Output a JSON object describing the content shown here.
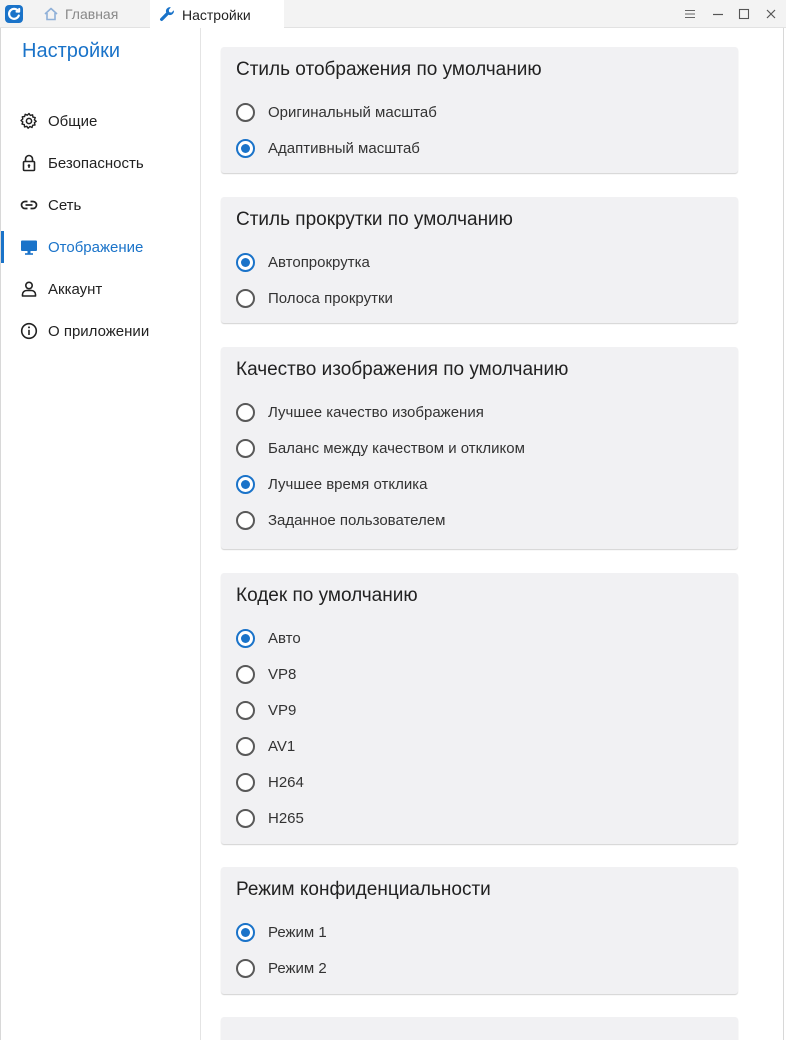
{
  "titlebar": {
    "tabs": [
      {
        "label": "Главная",
        "icon": "home-icon"
      },
      {
        "label": "Настройки",
        "icon": "wrench-icon"
      }
    ],
    "controls": [
      "menu-icon",
      "minimize-icon",
      "maximize-icon",
      "close-icon"
    ]
  },
  "sidebar": {
    "title": "Настройки",
    "items": [
      {
        "label": "Общие",
        "icon": "gear-icon",
        "active": false
      },
      {
        "label": "Безопасность",
        "icon": "lock-icon",
        "active": false
      },
      {
        "label": "Сеть",
        "icon": "link-icon",
        "active": false
      },
      {
        "label": "Отображение",
        "icon": "monitor-icon",
        "active": true
      },
      {
        "label": "Аккаунт",
        "icon": "user-icon",
        "active": false
      },
      {
        "label": "О приложении",
        "icon": "info-icon",
        "active": false
      }
    ]
  },
  "sections": [
    {
      "title": "Стиль отображения по умолчанию",
      "options": [
        {
          "label": "Оригинальный масштаб",
          "checked": false
        },
        {
          "label": "Адаптивный масштаб",
          "checked": true
        }
      ]
    },
    {
      "title": "Стиль прокрутки по умолчанию",
      "options": [
        {
          "label": "Автопрокрутка",
          "checked": true
        },
        {
          "label": "Полоса прокрутки",
          "checked": false
        }
      ]
    },
    {
      "title": "Качество изображения по умолчанию",
      "options": [
        {
          "label": "Лучшее качество изображения",
          "checked": false
        },
        {
          "label": "Баланс между качеством и откликом",
          "checked": false
        },
        {
          "label": "Лучшее время отклика",
          "checked": true
        },
        {
          "label": "Заданное пользователем",
          "checked": false
        }
      ]
    },
    {
      "title": "Кодек по умолчанию",
      "options": [
        {
          "label": "Авто",
          "checked": true
        },
        {
          "label": "VP8",
          "checked": false
        },
        {
          "label": "VP9",
          "checked": false
        },
        {
          "label": "AV1",
          "checked": false
        },
        {
          "label": "H264",
          "checked": false
        },
        {
          "label": "H265",
          "checked": false
        }
      ]
    },
    {
      "title": "Режим конфиденциальности",
      "options": [
        {
          "label": "Режим 1",
          "checked": true
        },
        {
          "label": "Режим 2",
          "checked": false
        }
      ]
    }
  ],
  "colors": {
    "accent": "#1a73c9",
    "card_bg": "#f1f1f3",
    "radio_border": "#595959"
  }
}
